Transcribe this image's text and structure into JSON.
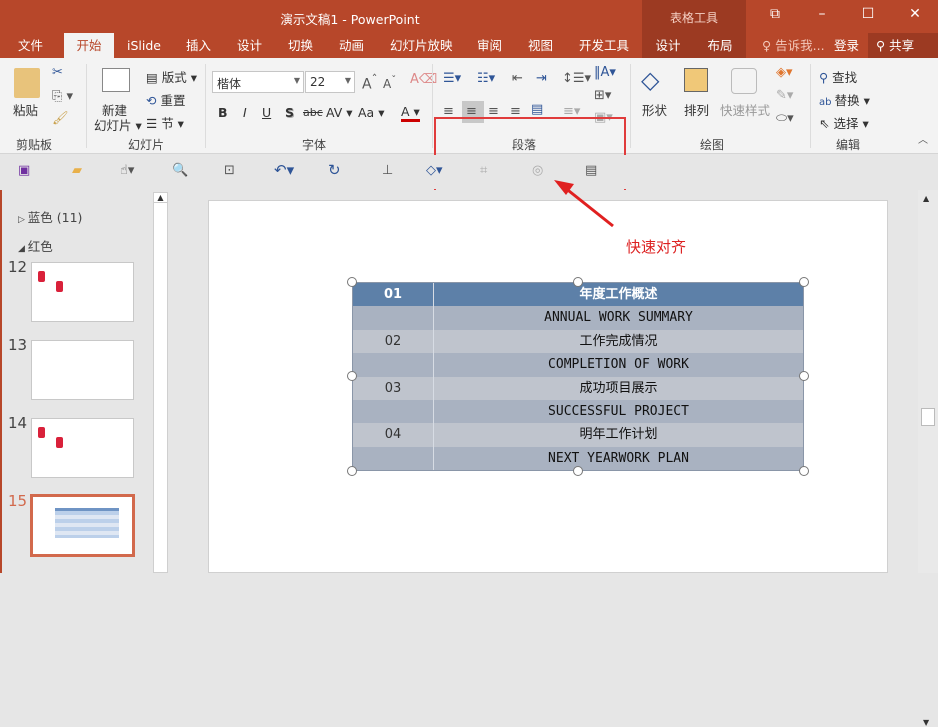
{
  "window": {
    "title": "演示文稿1 - PowerPoint",
    "context_tab_group": "表格工具"
  },
  "tabs": [
    "文件",
    "开始",
    "iSlide",
    "插入",
    "设计",
    "切换",
    "动画",
    "幻灯片放映",
    "审阅",
    "视图",
    "开发工具",
    "设计",
    "布局"
  ],
  "active_tab": "开始",
  "tell_me": "告诉我...",
  "login": "登录",
  "share": "共享",
  "ribbon": {
    "clipboard": {
      "label": "剪贴板",
      "paste": "粘贴"
    },
    "slides": {
      "label": "幻灯片",
      "new_slide_1": "新建",
      "new_slide_2": "幻灯片",
      "layout": "版式",
      "reset": "重置",
      "section": "节"
    },
    "font": {
      "label": "字体",
      "font_name": "楷体",
      "font_size": "22",
      "bold": "B",
      "italic": "I",
      "underline": "U",
      "shadow": "S",
      "strike": "abc",
      "spacing": "AV",
      "case": "Aa",
      "color": "A"
    },
    "paragraph": {
      "label": "段落"
    },
    "drawing": {
      "label": "绘图",
      "shapes": "形状",
      "arrange": "排列",
      "quick_styles": "快速样式"
    },
    "editing": {
      "label": "编辑",
      "find": "查找",
      "replace": "替换",
      "select": "选择"
    }
  },
  "panel": {
    "sections": [
      {
        "label": "蓝色 (11)",
        "collapsed": true
      },
      {
        "label": "红色",
        "collapsed": false
      }
    ],
    "slides": [
      "12",
      "13",
      "14",
      "15"
    ],
    "selected_slide": "15"
  },
  "table": {
    "rows": [
      {
        "num": "01",
        "text": "年度工作概述",
        "header": true
      },
      {
        "num": "",
        "text": "ANNUAL WORK SUMMARY"
      },
      {
        "num": "02",
        "text": "工作完成情况"
      },
      {
        "num": "",
        "text": "COMPLETION OF WORK"
      },
      {
        "num": "03",
        "text": "成功项目展示"
      },
      {
        "num": "",
        "text": "SUCCESSFUL PROJECT"
      },
      {
        "num": "04",
        "text": "明年工作计划"
      },
      {
        "num": "",
        "text": "NEXT YEARWORK PLAN"
      }
    ]
  },
  "annotation": {
    "text": "快速对齐",
    "color": "#dd2222"
  },
  "colors": {
    "brand": "#b7472a",
    "table_header": "#5d80a8",
    "row_light": "#bfc4cd",
    "row_dark": "#a9b2c1",
    "highlight_box": "#e03b3b"
  }
}
